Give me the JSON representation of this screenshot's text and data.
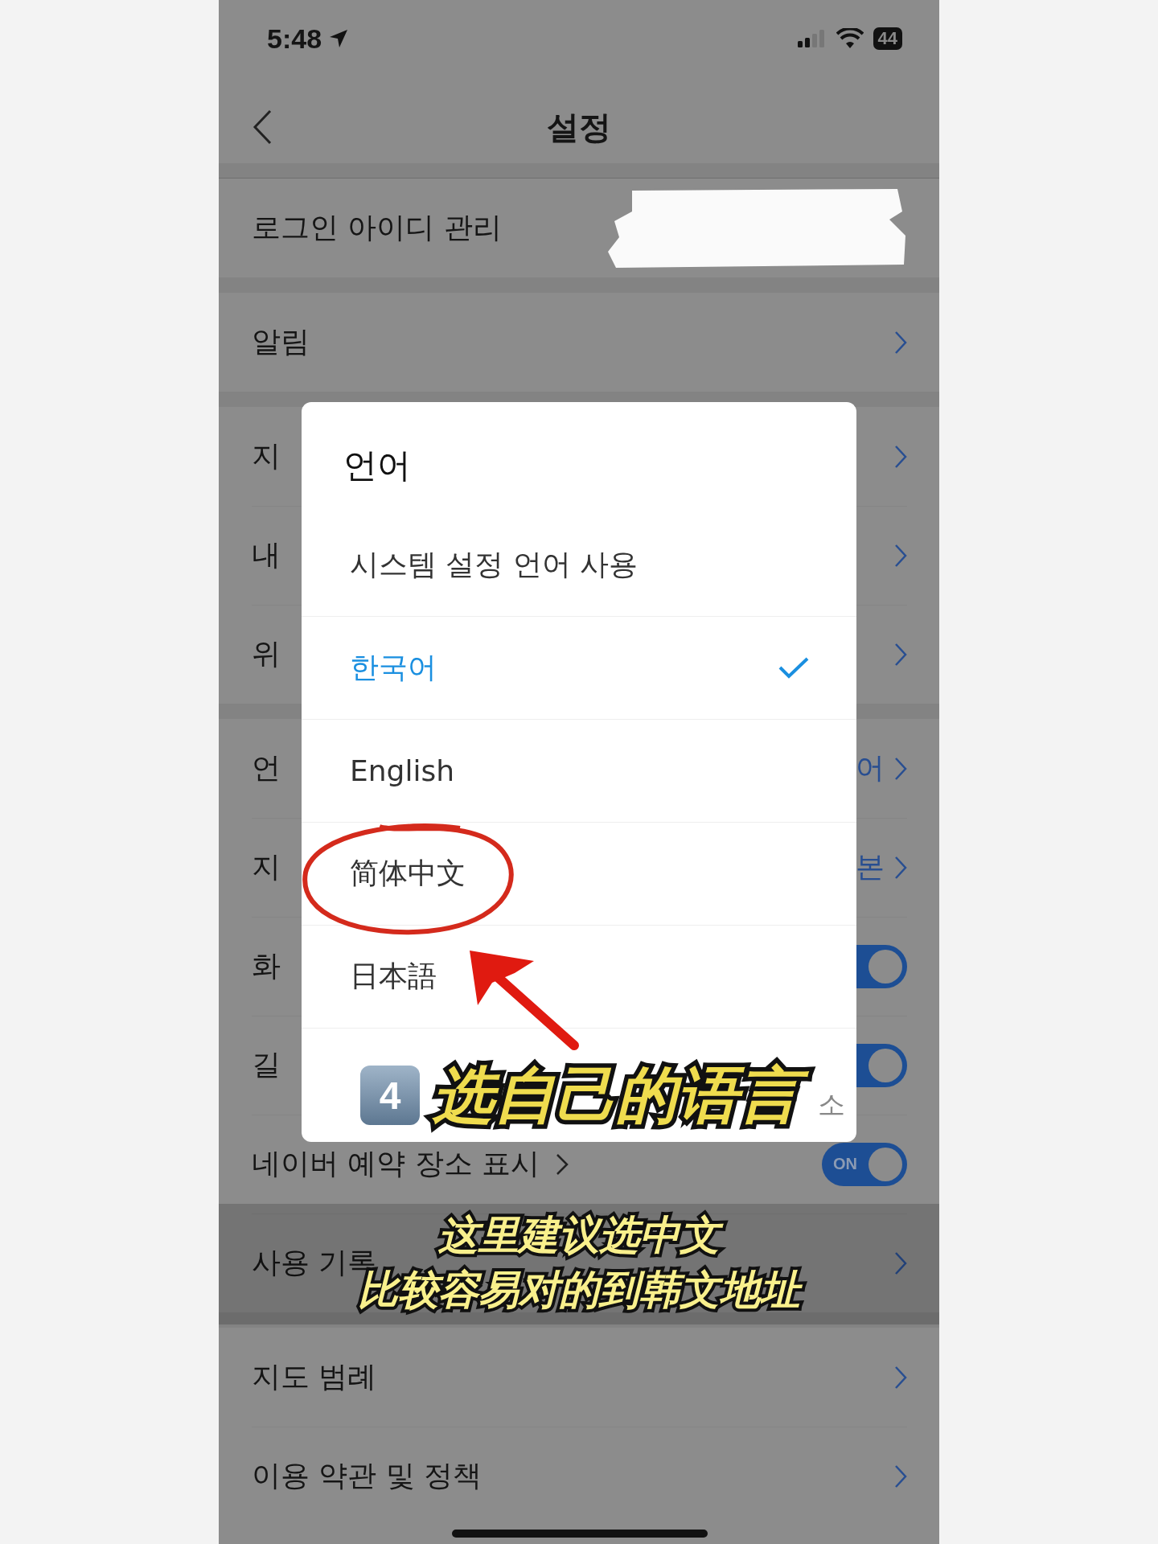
{
  "status_bar": {
    "time": "5:48",
    "battery": "44"
  },
  "nav": {
    "title": "설정"
  },
  "sections": [
    {
      "rows": [
        {
          "label": "로그인 아이디 관리",
          "kind": "redacted"
        }
      ]
    },
    {
      "rows": [
        {
          "label": "알림",
          "kind": "link"
        }
      ]
    },
    {
      "rows": [
        {
          "label": "지",
          "kind": "link"
        },
        {
          "label": "내",
          "kind": "link"
        },
        {
          "label": "위",
          "kind": "link"
        }
      ]
    },
    {
      "rows": [
        {
          "label": "언",
          "kind": "link",
          "value": "어"
        },
        {
          "label": "지",
          "kind": "link",
          "value": "본"
        },
        {
          "label": "화",
          "kind": "toggle",
          "on": true
        },
        {
          "label": "길",
          "kind": "toggle",
          "on": true
        },
        {
          "label": "네이버 예약 장소 표시",
          "kind": "toggle",
          "on": true,
          "chevron": true,
          "toggle_label": "ON"
        },
        {
          "label": "사용 기록",
          "kind": "link"
        }
      ]
    },
    {
      "rows": [
        {
          "label": "지도 범례",
          "kind": "link"
        },
        {
          "label": "이용 약관 및 정책",
          "kind": "link"
        }
      ]
    }
  ],
  "dialog": {
    "title": "언어",
    "options": [
      {
        "label": "시스템 설정 언어 사용",
        "selected": false
      },
      {
        "label": "한국어",
        "selected": true
      },
      {
        "label": "English",
        "selected": false
      },
      {
        "label": "简体中文",
        "selected": false
      },
      {
        "label": "日本語",
        "selected": false
      }
    ],
    "cancel": "소"
  },
  "annotations": {
    "step": "4",
    "step_caption": "选自己的语言",
    "captions": [
      "这里建议选中文",
      "比较容易对的到韩文地址"
    ]
  }
}
